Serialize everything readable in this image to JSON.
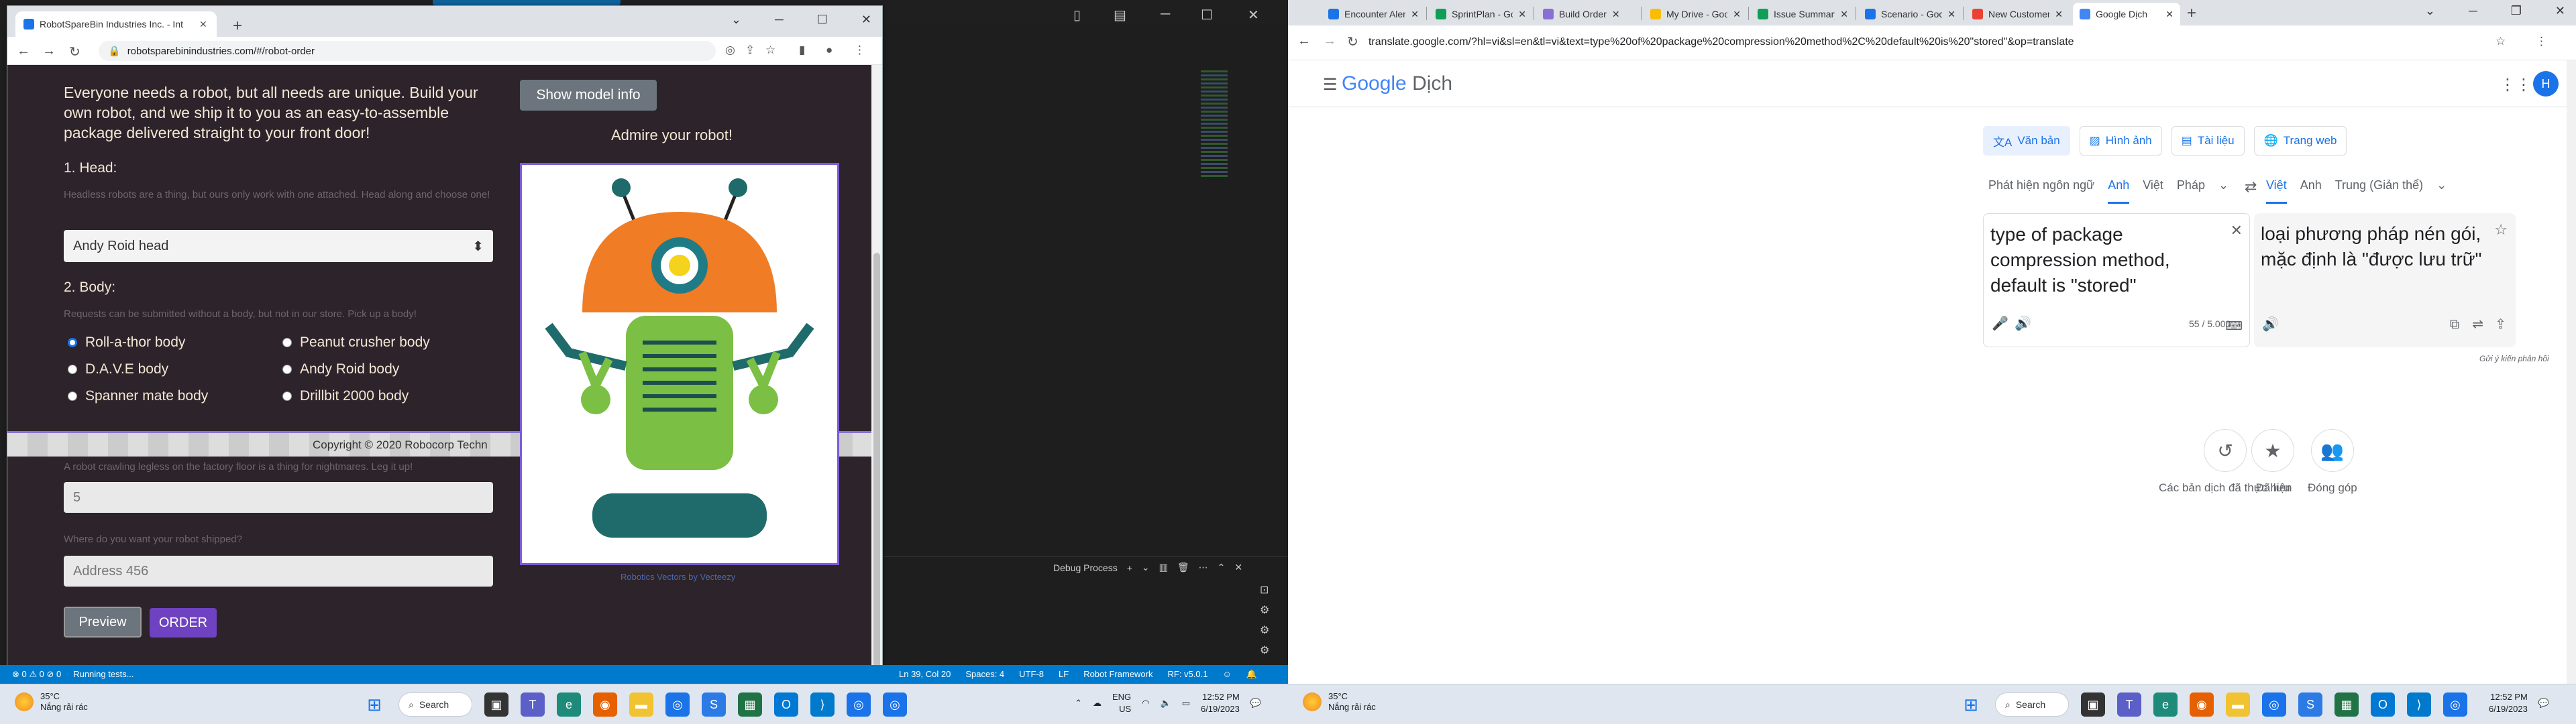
{
  "left_chrome": {
    "tab_title": "RobotSpareBin Industries Inc. - Int",
    "url": "robotsparebinindustries.com/#/robot-order"
  },
  "page": {
    "intro": "Everyone needs a robot, but all needs are unique. Build your own robot, and we ship it to you as an easy-to-assemble package delivered straight to your front door!",
    "head_label": "1. Head:",
    "head_hint": "Headless robots are a thing, but ours only work with one attached. Head along and choose one!",
    "head_selected": "Andy Roid head",
    "body_label": "2. Body:",
    "body_hint": "Requests can be submitted without a body, but not in our store. Pick up a body!",
    "bodies": [
      "Roll-a-thor body",
      "Peanut crusher body",
      "D.A.V.E body",
      "Andy Roid body",
      "Spanner mate body",
      "Drillbit 2000 body"
    ],
    "copyright": "Copyright © 2020 Robocorp Techn",
    "legs_hint": "A robot crawling legless on the factory floor is a thing for nightmares. Leg it up!",
    "legs_value": "5",
    "address_hint": "Where do you want your robot shipped?",
    "address_value": "Address 456",
    "preview_label": "Preview",
    "order_label": "ORDER",
    "show_model_label": "Show model info",
    "admire_label": "Admire your robot!",
    "credit": "Robotics Vectors by Vecteezy"
  },
  "vscode": {
    "debug_label": "Debug Process",
    "status_left": [
      "⊗ 0 ⚠ 0 ⊘ 0",
      "Running tests..."
    ],
    "status_right": [
      "Ln 39, Col 20",
      "Spaces: 4",
      "UTF-8",
      "LF",
      "Robot Framework",
      "RF: v5.0.1"
    ]
  },
  "taskbar": {
    "temp": "35°C",
    "condition": "Nắng rải rác",
    "search_label": "Search",
    "lang_line1": "ENG",
    "lang_line2": "US",
    "time": "12:52 PM",
    "date": "6/19/2023"
  },
  "right_chrome": {
    "tabs": [
      "Encounter Alert C",
      "SprintPlan - Goog",
      "Build Order",
      "My Drive - Google",
      "Issue Summary - ",
      "Scenario - Googl",
      "New Customer Fo",
      "Google Dịch"
    ],
    "url": "translate.google.com/?hl=vi&sl=en&tl=vi&text=type%20of%20package%20compression%20method%2C%20default%20is%20\"stored\"&op=translate"
  },
  "translate": {
    "logo_google": "Google",
    "logo_dich": "Dịch",
    "avatar": "H",
    "tools": [
      "Văn bản",
      "Hình ảnh",
      "Tài liệu",
      "Trang web"
    ],
    "src_langs": [
      "Phát hiện ngôn ngữ",
      "Anh",
      "Việt",
      "Pháp"
    ],
    "tgt_langs": [
      "Việt",
      "Anh",
      "Trung (Giản thể)"
    ],
    "source_text": "type of package compression method, default is \"stored\"",
    "char_count": "55 / 5.000",
    "target_text": "loại phương pháp nén gói, mặc định là \"được lưu trữ\"",
    "feedback": "Gửi ý kiến phản hồi",
    "bottom": [
      "Các bản dịch đã thực hiện",
      "Đã lưu",
      "Đóng góp"
    ]
  }
}
